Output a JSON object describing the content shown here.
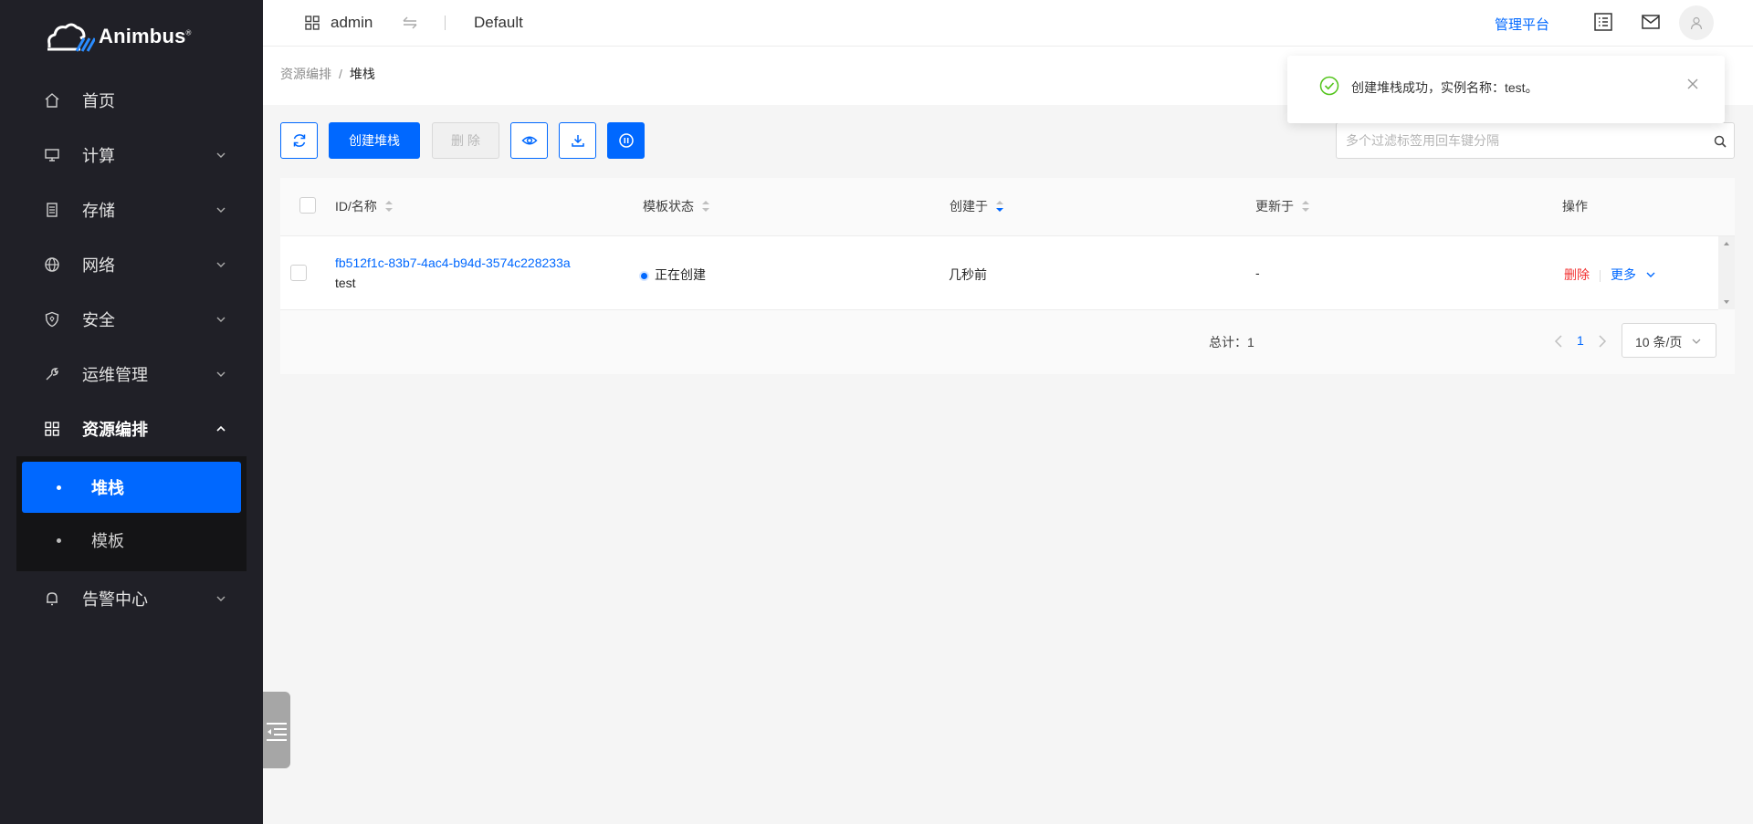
{
  "brand": {
    "name": "Animbus",
    "mark": "®"
  },
  "sidebar": {
    "items": [
      {
        "label": "首页",
        "icon": "home-icon"
      },
      {
        "label": "计算",
        "icon": "monitor-icon"
      },
      {
        "label": "存储",
        "icon": "storage-icon"
      },
      {
        "label": "网络",
        "icon": "globe-icon"
      },
      {
        "label": "安全",
        "icon": "shield-icon"
      },
      {
        "label": "运维管理",
        "icon": "wrench-icon"
      },
      {
        "label": "资源编排",
        "icon": "grid-icon"
      },
      {
        "label": "告警中心",
        "icon": "bell-icon"
      }
    ],
    "sub_items": [
      {
        "label": "堆栈",
        "active": true
      },
      {
        "label": "模板",
        "active": false
      }
    ]
  },
  "header": {
    "user": "admin",
    "project": "Default",
    "admin_link": "管理平台"
  },
  "breadcrumb": {
    "parent": "资源编排",
    "separator": "/",
    "current": "堆栈"
  },
  "toolbar": {
    "create_label": "创建堆栈",
    "delete_label": "删 除",
    "search_placeholder": "多个过滤标签用回车键分隔"
  },
  "table": {
    "columns": [
      "ID/名称",
      "模板状态",
      "创建于",
      "更新于",
      "操作"
    ],
    "rows": [
      {
        "id": "fb512f1c-83b7-4ac4-b94d-3574c228233a",
        "name": "test",
        "status": "正在创建",
        "created": "几秒前",
        "updated": "-",
        "op_delete": "删除",
        "op_more": "更多"
      }
    ]
  },
  "pagination": {
    "total": "总计：1",
    "current_page": "1",
    "page_size": "10 条/页"
  },
  "toast": {
    "message": "创建堆栈成功，实例名称：test。"
  },
  "colors": {
    "primary": "#0068ff",
    "sidebar_bg": "#202027",
    "danger": "#f23030",
    "success": "#52c41a"
  }
}
